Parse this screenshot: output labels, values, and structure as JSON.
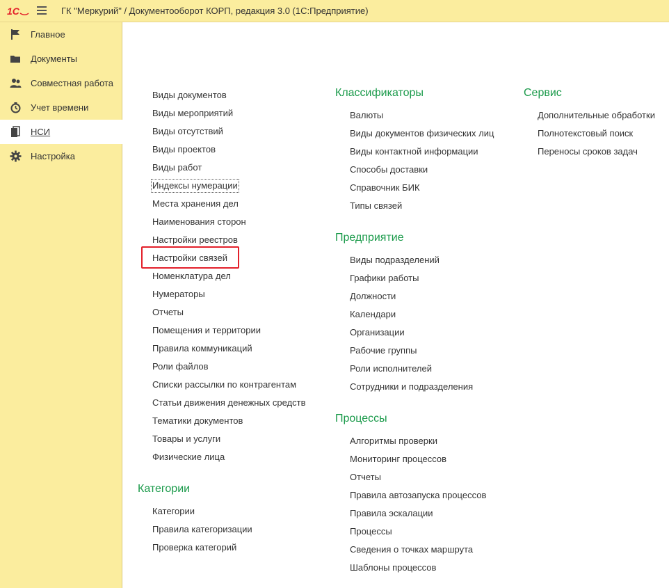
{
  "window": {
    "logo": "1С",
    "title": "ГК \"Меркурий\" / Документооборот КОРП, редакция 3.0  (1С:Предприятие)"
  },
  "sidebar": {
    "items": [
      {
        "label": "Главное",
        "icon": "flag-icon"
      },
      {
        "label": "Документы",
        "icon": "folder-icon"
      },
      {
        "label": "Совместная работа",
        "icon": "users-icon"
      },
      {
        "label": "Учет времени",
        "icon": "timer-icon"
      },
      {
        "label": "НСИ",
        "icon": "reference-books-icon",
        "active": true
      },
      {
        "label": "Настройка",
        "icon": "gear-icon"
      }
    ]
  },
  "main": {
    "column1": {
      "links": [
        "Виды документов",
        "Виды мероприятий",
        "Виды отсутствий",
        "Виды проектов",
        "Виды работ",
        "Индексы нумерации",
        "Места хранения дел",
        "Наименования сторон",
        "Настройки реестров",
        "Настройки связей",
        "Номенклатура дел",
        "Нумераторы",
        "Отчеты",
        "Помещения и территории",
        "Правила коммуникаций",
        "Роли файлов",
        "Списки рассылки по контрагентам",
        "Статьи движения денежных средств",
        "Тематики документов",
        "Товары и услуги",
        "Физические лица"
      ],
      "categories": {
        "title": "Категории",
        "links": [
          "Категории",
          "Правила категоризации",
          "Проверка категорий"
        ]
      }
    },
    "column2": {
      "classifiers": {
        "title": "Классификаторы",
        "links": [
          "Валюты",
          "Виды документов физических лиц",
          "Виды контактной информации",
          "Способы доставки",
          "Справочник БИК",
          "Типы связей"
        ]
      },
      "enterprise": {
        "title": "Предприятие",
        "links": [
          "Виды подразделений",
          "Графики работы",
          "Должности",
          "Календари",
          "Организации",
          "Рабочие группы",
          "Роли исполнителей",
          "Сотрудники и подразделения"
        ]
      },
      "processes": {
        "title": "Процессы",
        "links": [
          "Алгоритмы проверки",
          "Мониторинг процессов",
          "Отчеты",
          "Правила автозапуска процессов",
          "Правила эскалации",
          "Процессы",
          "Сведения о точках маршрута",
          "Шаблоны процессов"
        ]
      }
    },
    "column3": {
      "service": {
        "title": "Сервис",
        "links": [
          "Дополнительные обработки",
          "Полнотекстовый поиск",
          "Переносы сроков задач"
        ]
      }
    }
  },
  "colors": {
    "panel_bg": "#fbed9e",
    "section_title": "#1a9a4a",
    "highlight": "#e3202a",
    "logo_red": "#e3202a"
  }
}
